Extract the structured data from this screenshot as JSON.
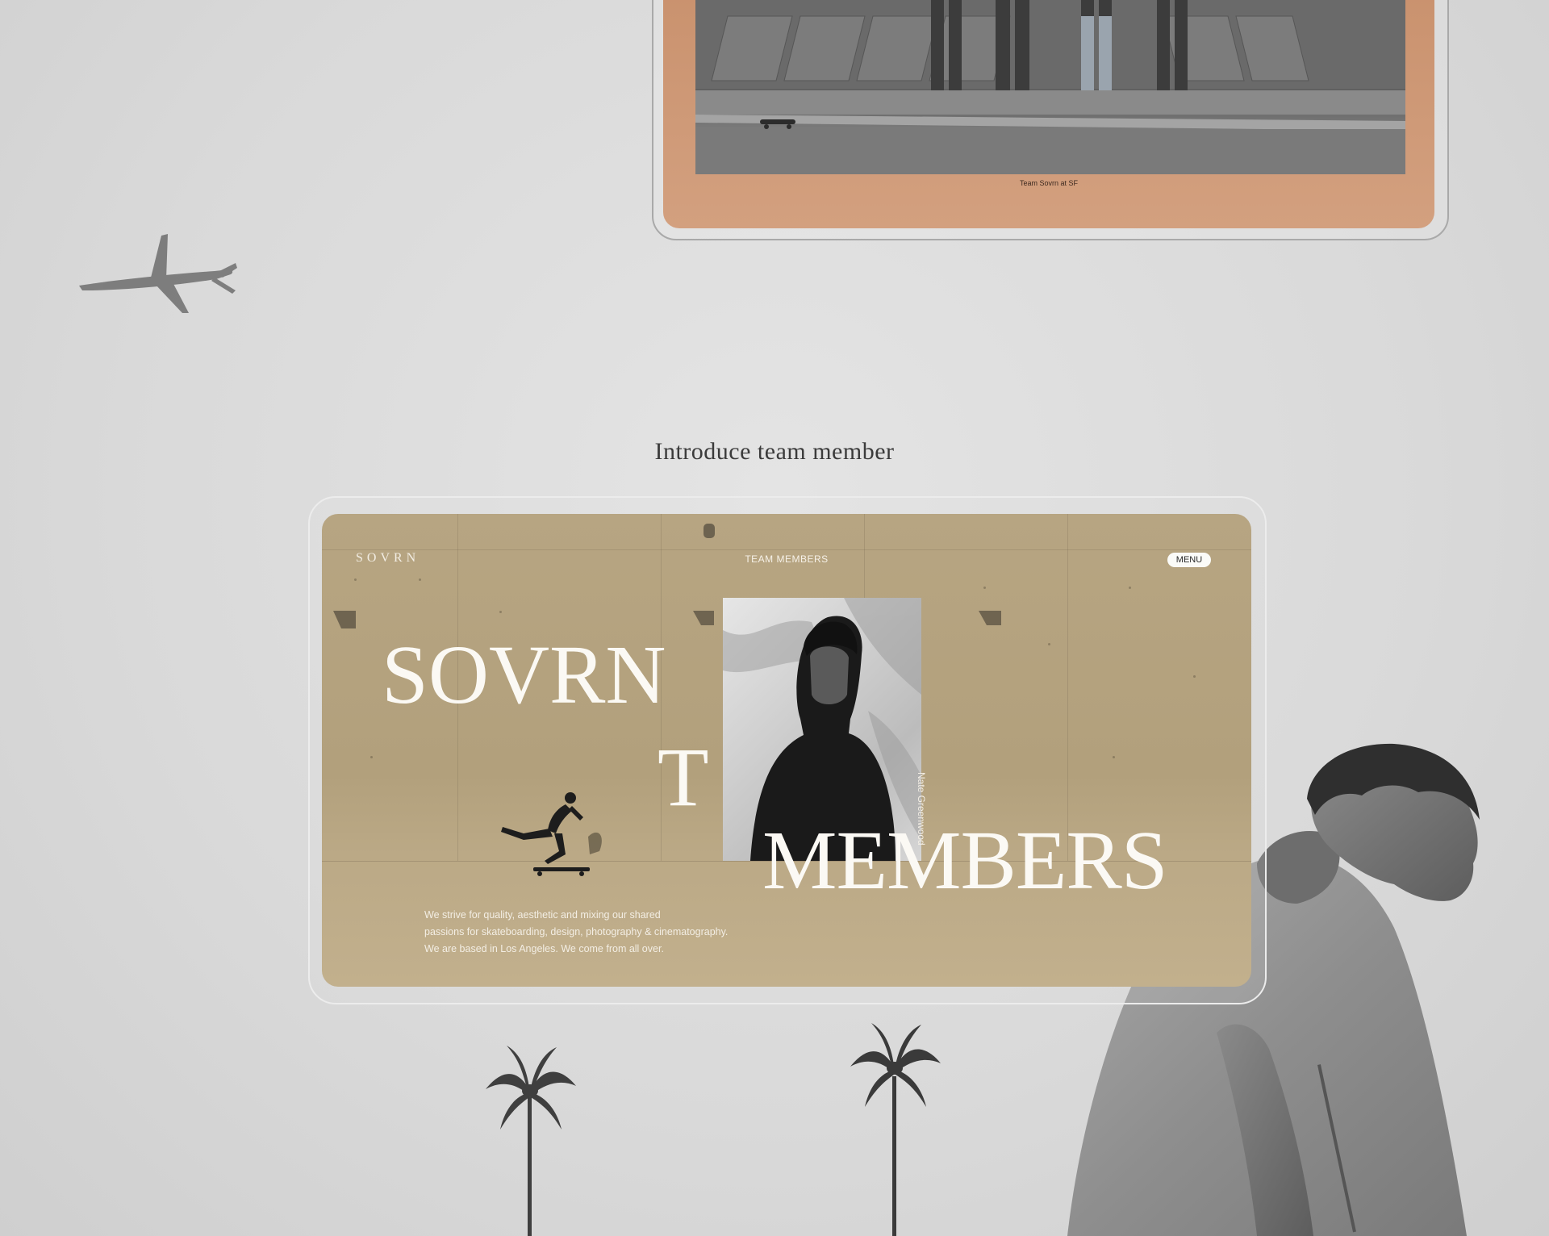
{
  "top_preview": {
    "caption": "Team Sovrn at SF"
  },
  "section": {
    "title": "Introduce team member"
  },
  "site": {
    "logo": "SOVRN",
    "nav_title": "TEAM MEMBERS",
    "menu_label": "MENU",
    "hero": {
      "line1": "SOVRN",
      "line2": "T",
      "line3": "MEMBERS"
    },
    "member": {
      "name": "Nate Greenwood"
    },
    "intro": [
      "We strive for quality, aesthetic and mixing our shared",
      "passions for skateboarding, design, photography & cinematography.",
      "We are based in Los Angeles. We come from all over."
    ]
  },
  "colors": {
    "page_bg": "#dddddd",
    "screen_bg": "#b5a380",
    "top_screen_bg": "#cc9673",
    "hero_text": "#fbf9f4"
  },
  "icons": [
    "airplane-icon",
    "palm-tree-icon"
  ]
}
